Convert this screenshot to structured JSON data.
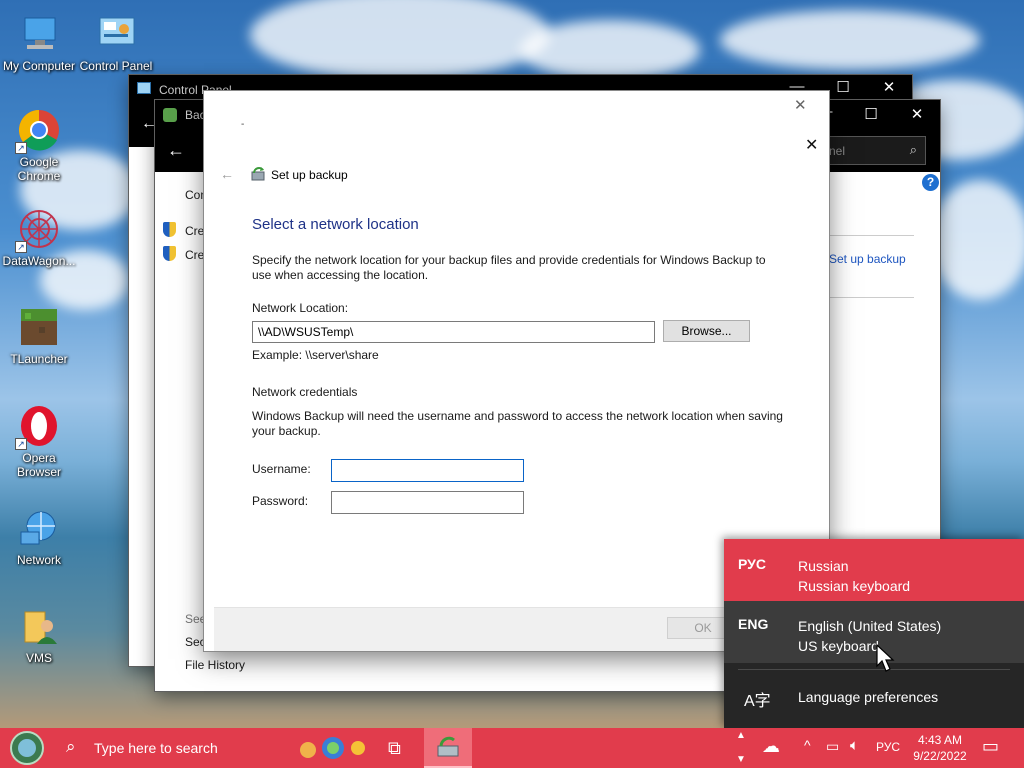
{
  "desktop": {
    "icons": [
      {
        "label": "My Computer",
        "icon": "computer-icon"
      },
      {
        "label": "Control Panel",
        "icon": "control-panel-icon"
      },
      {
        "label": "Google Chrome",
        "icon": "chrome-icon"
      },
      {
        "label": "DataWagon...",
        "icon": "datawagon-icon"
      },
      {
        "label": "TLauncher",
        "icon": "tlauncher-icon"
      },
      {
        "label": "Opera Browser",
        "icon": "opera-icon"
      },
      {
        "label": "Network",
        "icon": "network-icon"
      },
      {
        "label": "VMS",
        "icon": "folder-user-icon"
      }
    ]
  },
  "control_panel_window": {
    "title": "Control Panel"
  },
  "backup_window": {
    "title": "Bac",
    "search_placeholder": "nel",
    "left_items": [
      "Con",
      "Crea",
      "Crea"
    ],
    "see_also": "See",
    "security": "Secu",
    "file_history": "File History",
    "right_link": "Set up backup"
  },
  "dialog": {
    "title_dot": "-",
    "nav_title": "Set up backup",
    "heading": "Select a network location",
    "description": "Specify the network location for your backup files and provide credentials for Windows Backup to use when accessing the location.",
    "network_location_label": "Network Location:",
    "network_location_value": "\\\\AD\\WSUSTemp\\",
    "browse_label": "Browse...",
    "example_text": "Example: \\\\server\\share",
    "credentials_heading": "Network credentials",
    "credentials_text": "Windows Backup will need the username and password to access the network location when saving your backup.",
    "username_label": "Username:",
    "username_value": "",
    "password_label": "Password:",
    "password_value": "",
    "ok_label": "OK"
  },
  "language_panel": {
    "items": [
      {
        "code": "РУС",
        "name": "Russian",
        "keyboard": "Russian keyboard",
        "selected": true
      },
      {
        "code": "ENG",
        "name": "English (United States)",
        "keyboard": "US keyboard",
        "selected": false
      }
    ],
    "preferences_label": "Language preferences"
  },
  "taskbar": {
    "search_placeholder": "Type here to search",
    "lang_indicator": "РУС",
    "time": "4:43 AM",
    "date": "9/22/2022",
    "accent_color": "#e13c4c"
  }
}
